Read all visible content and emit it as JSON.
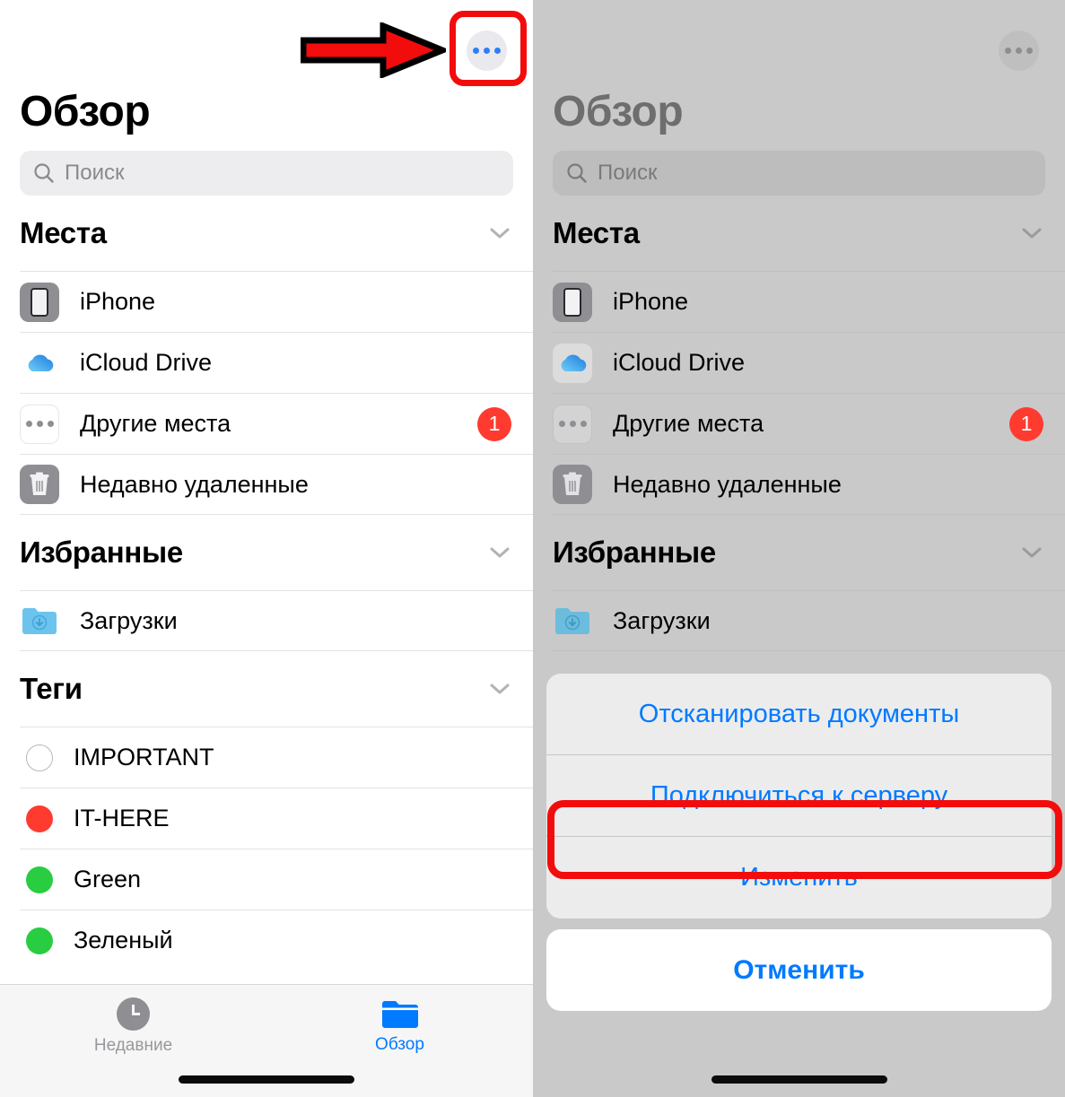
{
  "app": {
    "title": "Обзор",
    "search_placeholder": "Поиск",
    "more_button_icon": "ellipsis-icon"
  },
  "sections": [
    {
      "id": "places",
      "title": "Места",
      "chevron": "chevron-down-icon",
      "items": [
        {
          "label": "iPhone",
          "icon": "iphone-icon",
          "badge": ""
        },
        {
          "label": "iCloud Drive",
          "icon": "icloud-icon",
          "badge": ""
        },
        {
          "label": "Другие места",
          "icon": "ellipsis-box-icon",
          "badge": "1"
        },
        {
          "label": "Недавно удаленные",
          "icon": "trash-icon",
          "badge": ""
        }
      ]
    },
    {
      "id": "favorites",
      "title": "Избранные",
      "chevron": "chevron-down-icon",
      "items": [
        {
          "label": "Загрузки",
          "icon": "downloads-folder-icon",
          "badge": ""
        }
      ]
    },
    {
      "id": "tags",
      "title": "Теги",
      "chevron": "chevron-down-icon",
      "items": [
        {
          "label": "IMPORTANT",
          "icon": "tag-dot-icon",
          "color": "#ffffff",
          "badge": ""
        },
        {
          "label": "IT-HERE",
          "icon": "tag-dot-icon",
          "color": "#ff3b30",
          "badge": ""
        },
        {
          "label": "Green",
          "icon": "tag-dot-icon",
          "color": "#28cd41",
          "badge": ""
        },
        {
          "label": "Зеленый",
          "icon": "tag-dot-icon",
          "color": "#28cd41",
          "badge": ""
        }
      ]
    }
  ],
  "tabbar": {
    "tabs": [
      {
        "label": "Недавние",
        "icon": "clock-icon",
        "active": false
      },
      {
        "label": "Обзор",
        "icon": "folder-icon",
        "active": true
      }
    ]
  },
  "action_sheet": {
    "items": [
      {
        "label": "Отсканировать документы",
        "highlighted": false
      },
      {
        "label": "Подключиться к серверу",
        "highlighted": true
      },
      {
        "label": "Изменить",
        "highlighted": false
      }
    ],
    "cancel_label": "Отменить"
  },
  "annotations": {
    "arrow_color": "#f30c0c",
    "arrow_outline_color": "#000000",
    "box_color": "#f30c0c",
    "targets": [
      "more-button",
      "connect-to-server-item"
    ]
  },
  "colors": {
    "accent_blue": "#007aff",
    "badge_red": "#ff3b30",
    "tag_green": "#28cd41",
    "tag_red": "#ff3b30",
    "annotation_red": "#f30c0c"
  }
}
